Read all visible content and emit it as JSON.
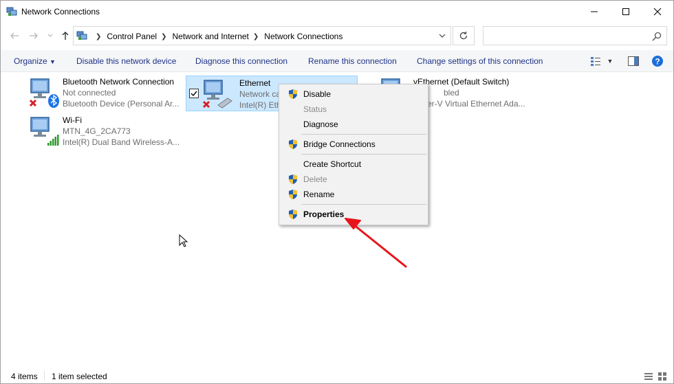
{
  "window": {
    "title": "Network Connections"
  },
  "address": {
    "crumbs": [
      "Control Panel",
      "Network and Internet",
      "Network Connections"
    ],
    "search_placeholder": ""
  },
  "commands": {
    "organize": "Organize",
    "disable": "Disable this network device",
    "diagnose": "Diagnose this connection",
    "rename": "Rename this connection",
    "change": "Change settings of this connection"
  },
  "connections": [
    {
      "name": "Bluetooth Network Connection",
      "status": "Not connected",
      "device": "Bluetooth Device (Personal Ar..."
    },
    {
      "name": "Ethernet",
      "status": "Network ca",
      "device": "Intel(R) Eth"
    },
    {
      "name": "vEthernet (Default Switch)",
      "status": "bled",
      "device": "er-V Virtual Ethernet Ada..."
    },
    {
      "name": "Wi-Fi",
      "status": "MTN_4G_2CA773",
      "device": "Intel(R) Dual Band Wireless-A..."
    }
  ],
  "context_menu": {
    "disable": "Disable",
    "status": "Status",
    "diagnose": "Diagnose",
    "bridge": "Bridge Connections",
    "shortcut": "Create Shortcut",
    "delete": "Delete",
    "rename": "Rename",
    "properties": "Properties"
  },
  "statusbar": {
    "count": "4 items",
    "selected": "1 item selected"
  },
  "colors": {
    "selection": "#cce8ff",
    "command_text": "#1e3287",
    "annotation_arrow": "#e8141b"
  }
}
